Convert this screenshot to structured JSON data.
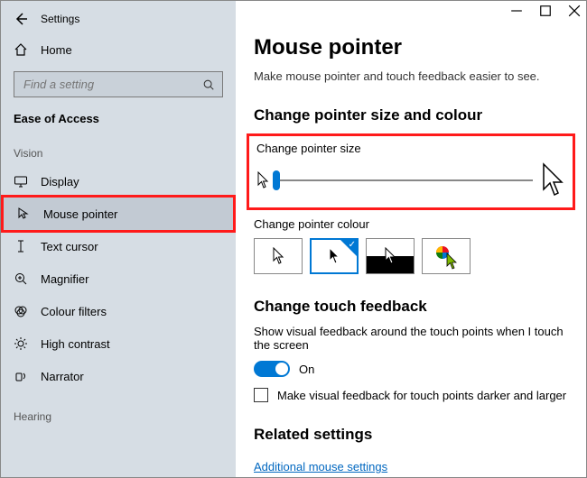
{
  "app_title": "Settings",
  "home_label": "Home",
  "search_placeholder": "Find a setting",
  "category": "Ease of Access",
  "groups": {
    "vision": "Vision",
    "hearing": "Hearing"
  },
  "nav": {
    "display": "Display",
    "mouse_pointer": "Mouse pointer",
    "text_cursor": "Text cursor",
    "magnifier": "Magnifier",
    "colour_filters": "Colour filters",
    "high_contrast": "High contrast",
    "narrator": "Narrator"
  },
  "page": {
    "title": "Mouse pointer",
    "subtitle": "Make mouse pointer and touch feedback easier to see.",
    "section_size_colour": "Change pointer size and colour",
    "change_size_label": "Change pointer size",
    "change_colour_label": "Change pointer colour",
    "section_touch": "Change touch feedback",
    "touch_desc": "Show visual feedback around the touch points when I touch the screen",
    "toggle_on": "On",
    "checkbox_label": "Make visual feedback for touch points darker and larger",
    "section_related": "Related settings",
    "link_additional": "Additional mouse settings"
  }
}
